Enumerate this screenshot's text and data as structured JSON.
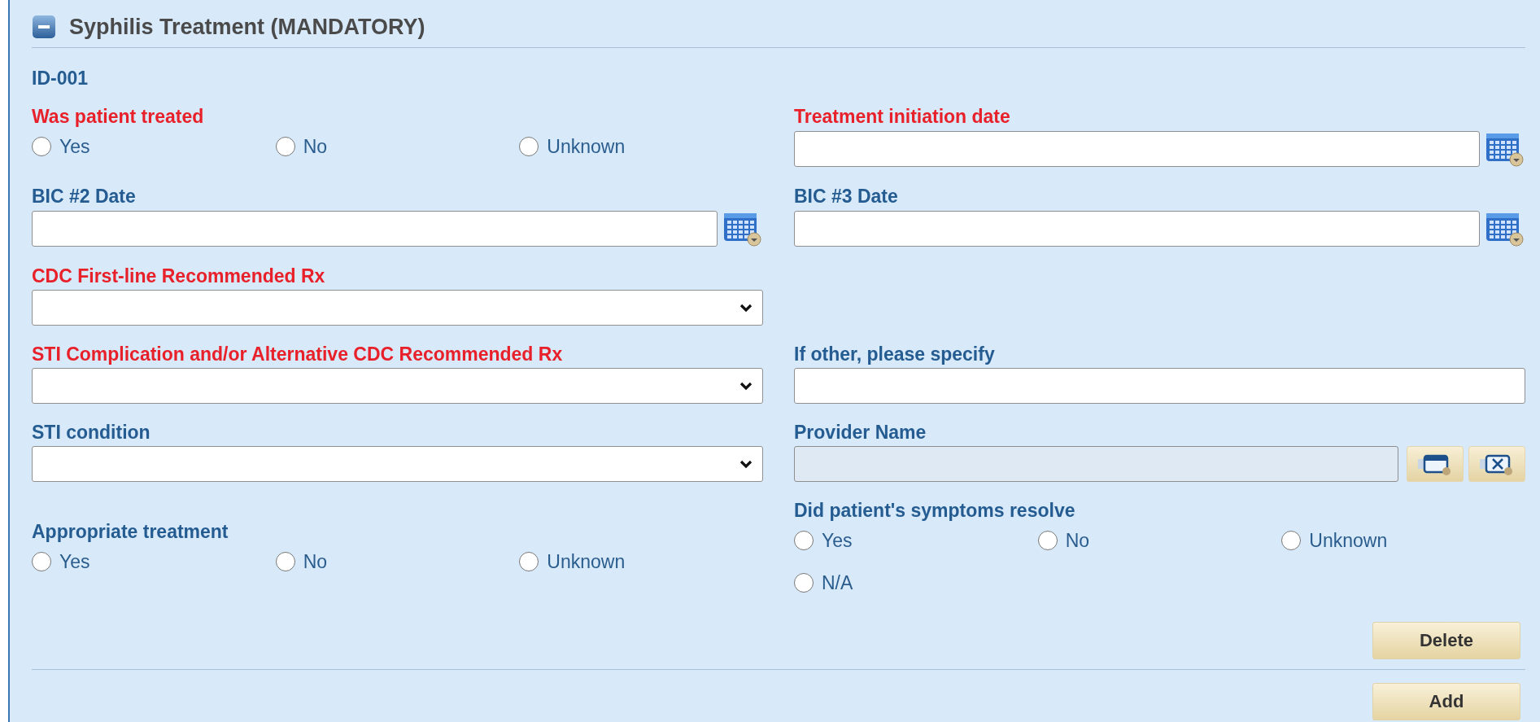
{
  "section": {
    "title": "Syphilis Treatment (MANDATORY)",
    "expanded": true,
    "record_id": "ID-001",
    "rows": [
      {
        "left": {
          "kind": "radio",
          "label": "Was patient treated",
          "required": true,
          "options": [
            {
              "label": "Yes",
              "selected": false
            },
            {
              "label": "No",
              "selected": false
            },
            {
              "label": "Unknown",
              "selected": false
            }
          ]
        },
        "right": {
          "kind": "date",
          "label": "Treatment initiation date",
          "required": true
        }
      },
      {
        "left": {
          "kind": "date",
          "label": "BIC #2 Date",
          "required": false
        },
        "right": {
          "kind": "date",
          "label": "BIC #3 Date",
          "required": false
        }
      },
      {
        "left": {
          "kind": "select",
          "label": "CDC First-line Recommended Rx",
          "required": true
        }
      },
      {
        "left": {
          "kind": "select",
          "label": "STI Complication and/or Alternative CDC Recommended Rx",
          "required": true
        },
        "right": {
          "kind": "text",
          "label": "If other, please specify",
          "required": false
        }
      },
      {
        "left": {
          "kind": "select",
          "label": "STI condition",
          "required": false
        },
        "right": {
          "kind": "lookup",
          "label": "Provider Name",
          "required": false,
          "disabled": true
        }
      },
      {
        "left": {
          "kind": "radio",
          "label": "Appropriate treatment",
          "required": false,
          "options": [
            {
              "label": "Yes",
              "selected": false
            },
            {
              "label": "No",
              "selected": false
            },
            {
              "label": "Unknown",
              "selected": false
            }
          ]
        },
        "right": {
          "kind": "radio",
          "label": "Did patient's symptoms resolve",
          "required": false,
          "options": [
            {
              "label": "Yes",
              "selected": false
            },
            {
              "label": "No",
              "selected": false
            },
            {
              "label": "Unknown",
              "selected": false
            },
            {
              "label": "N/A",
              "selected": false
            }
          ]
        }
      }
    ],
    "buttons": [
      {
        "label": "Delete"
      },
      {
        "label": "Add"
      }
    ]
  }
}
